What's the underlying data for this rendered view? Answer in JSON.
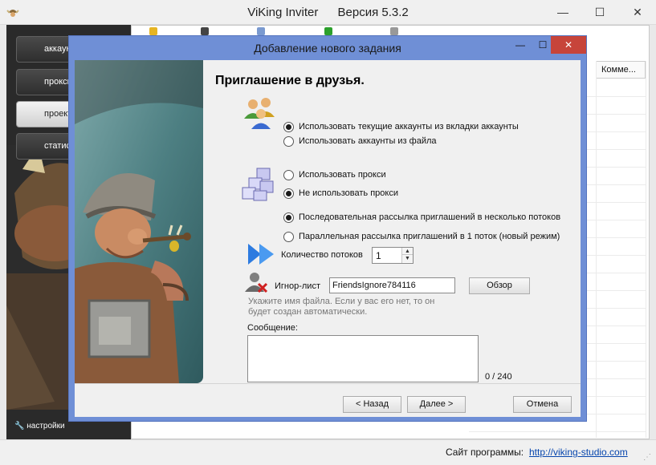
{
  "window": {
    "app_name": "ViKing Inviter",
    "version": "Версия 5.3.2",
    "minimize": "—",
    "maximize": "☐",
    "close": "✕"
  },
  "sidebar": {
    "items": [
      {
        "label": "аккаунты"
      },
      {
        "label": "прокси"
      },
      {
        "label": "проекты"
      },
      {
        "label": "статистика"
      }
    ],
    "settings_label": "настройки"
  },
  "grid": {
    "column_header": "Комме..."
  },
  "status": {
    "site_label": "Сайт программы:",
    "site_link": "http://viking-studio.com"
  },
  "dialog": {
    "title": "Добавление нового задания",
    "minimize": "—",
    "maximize": "☐",
    "close": "✕",
    "heading": "Приглашение в друзья.",
    "accounts": {
      "option_tab": "Использовать текущие аккаунты из вкладки аккаунты",
      "option_file": "Использовать аккаунты из файла",
      "selected": "option_tab"
    },
    "proxy": {
      "option_use": "Использовать прокси",
      "option_none": "Не использовать прокси",
      "selected": "option_none"
    },
    "mode": {
      "option_sequential": "Последовательная рассылка приглашений в несколько потоков",
      "option_parallel": "Параллельная рассылка приглашений в 1 поток (новый режим)",
      "selected": "option_sequential"
    },
    "threads": {
      "label": "Количество потоков",
      "value": "1"
    },
    "ignore": {
      "label": "Игнор-лист",
      "value": "FriendsIgnore784116",
      "browse": "Обзор",
      "hint": "Укажите имя файла. Если у вас его нет, то он будет создан автоматически."
    },
    "message": {
      "label": "Сообщение:",
      "counter": "0 / 240"
    },
    "buttons": {
      "back": "< Назад",
      "next": "Далее >",
      "cancel": "Отмена"
    }
  },
  "colors": {
    "dialog_frame": "#6f8fd6",
    "close_red": "#c7443a",
    "link_blue": "#0645ad"
  }
}
